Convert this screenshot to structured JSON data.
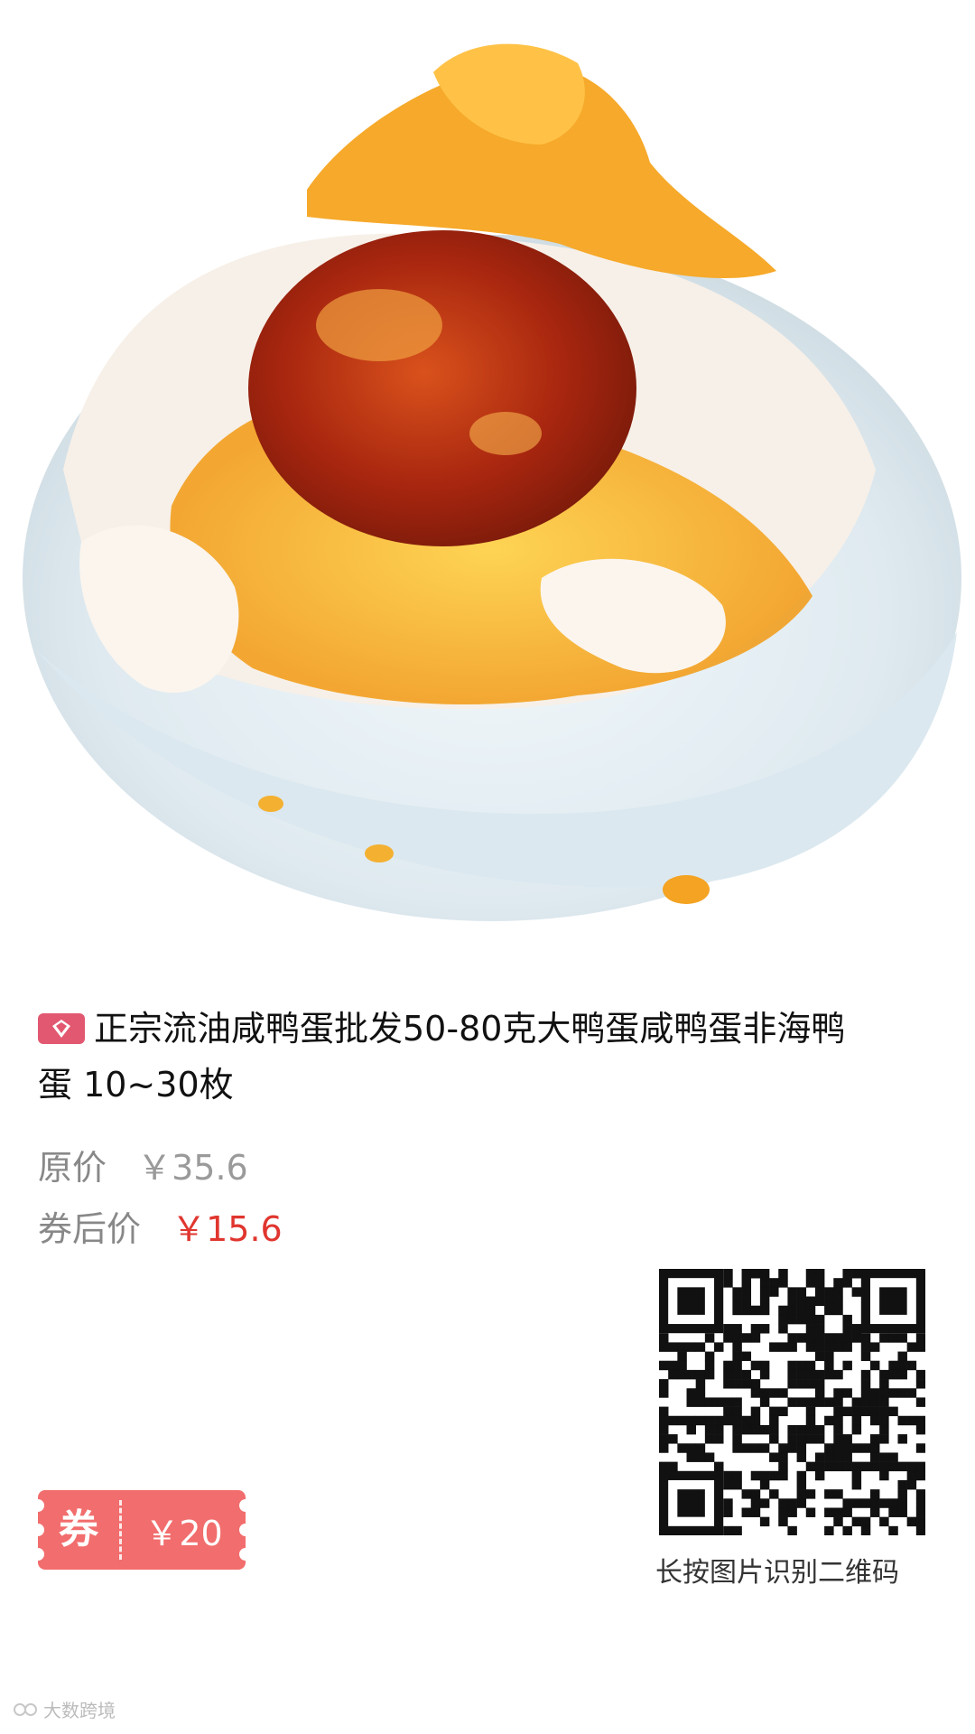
{
  "product": {
    "title": "正宗流油咸鸭蛋批发50-80克大鸭蛋咸鸭蛋非海鸭蛋 10~30枚",
    "image_alt": "salted-duck-egg-photo"
  },
  "prices": {
    "original_label": "原价",
    "original_value": "￥35.6",
    "after_label": "券后价",
    "after_value": "￥15.6"
  },
  "coupon": {
    "tag": "券",
    "amount": "￥20"
  },
  "qr": {
    "caption": "长按图片识别二维码"
  },
  "watermark": {
    "text": "大数跨境"
  },
  "colors": {
    "accent_red": "#e0362f",
    "coupon_bg": "#f26d6d",
    "shop_icon": "#e25870"
  }
}
